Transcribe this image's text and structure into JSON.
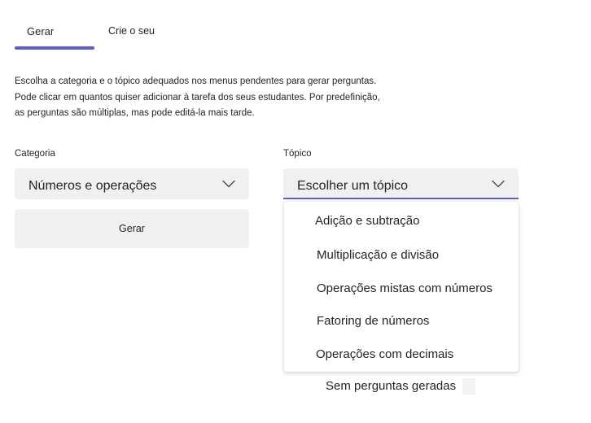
{
  "tabs": {
    "generate": "Gerar",
    "create": "Crie o seu"
  },
  "description": "Escolha a categoria e o tópico adequados nos menus pendentes para gerar perguntas. Pode clicar em quantos quiser adicionar à tarefa dos seus estudantes. Por predefinição, as perguntas são múltiplas, mas pode editá-la mais tarde.",
  "description_lines": [
    "Escolha a categoria e o tópico adequados nos menus pendentes para gerar perguntas.",
    "Pode clicar em quantos quiser adicionar à tarefa dos seus estudantes. Por predefinição,",
    "as perguntas são múltiplas, mas pode editá-la mais tarde."
  ],
  "category": {
    "label": "Categoria",
    "value": "Números e operações"
  },
  "topic": {
    "label": "Tópico",
    "value": "Escolher um tópico",
    "options": [
      "Adição e subtração",
      "Multiplicação e divisão",
      "Operações mistas com números",
      "Fatoring de números",
      "Operações com decimais"
    ]
  },
  "generate_button": "Gerar",
  "empty_state": "Sem perguntas geradas",
  "colors": {
    "accent": "#5b5fc7",
    "field_background": "#f0f0f0"
  },
  "icons": {
    "dropdown": "chevron-down-icon"
  }
}
